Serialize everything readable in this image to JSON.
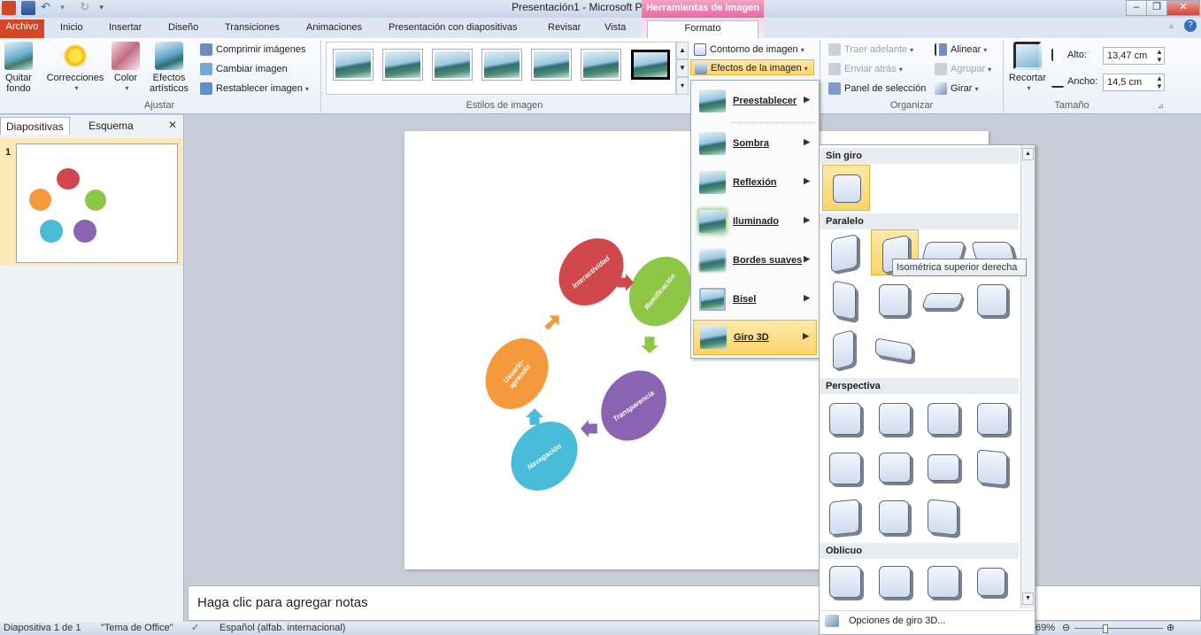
{
  "window": {
    "title": "Presentación1  -  Microsoft PowerPoint",
    "contextual_tab_group": "Herramientas de imagen"
  },
  "tabs": [
    {
      "label": "Archivo"
    },
    {
      "label": "Inicio"
    },
    {
      "label": "Insertar"
    },
    {
      "label": "Diseño"
    },
    {
      "label": "Transiciones"
    },
    {
      "label": "Animaciones"
    },
    {
      "label": "Presentación con diapositivas"
    },
    {
      "label": "Revisar"
    },
    {
      "label": "Vista"
    },
    {
      "label": "Formato"
    }
  ],
  "ribbon": {
    "ajustar": {
      "group_label": "Ajustar",
      "remove_bg": "Quitar\nfondo",
      "corrections": "Correcciones",
      "color": "Color",
      "artistic": "Efectos\nartísticos",
      "compress": "Comprimir imágenes",
      "change": "Cambiar imagen",
      "reset": "Restablecer imagen"
    },
    "estilos": {
      "group_label": "Estilos de imagen",
      "border": "Contorno de imagen",
      "effects": "Efectos de la imagen"
    },
    "organizar": {
      "group_label": "Organizar",
      "bring_forward": "Traer adelante",
      "send_backward": "Enviar atrás",
      "selection_pane": "Panel de selección",
      "align": "Alinear",
      "group": "Agrupar",
      "rotate": "Girar"
    },
    "tamano": {
      "group_label": "Tamaño",
      "crop": "Recortar",
      "height_label": "Alto:",
      "height_value": "13,47 cm",
      "width_label": "Ancho:",
      "width_value": "14,5 cm"
    }
  },
  "left_panel": {
    "tab_slides": "Diapositivas",
    "tab_outline": "Esquema",
    "close": "✕",
    "slide_number": "1"
  },
  "slide": {
    "shapes": [
      {
        "label": "Interactividad",
        "color": "#d0484b"
      },
      {
        "label": "Ramificación",
        "color": "#8ec646"
      },
      {
        "label": "Transparencia",
        "color": "#8a63b3"
      },
      {
        "label": "Navegación",
        "color": "#48bcd9"
      },
      {
        "label": "Usuario-aprendiz",
        "color": "#f59a3c"
      }
    ],
    "arrow_colors": [
      "#d0484b",
      "#8ec646",
      "#8a63b3",
      "#48bcd9",
      "#f59a3c"
    ]
  },
  "notes": {
    "placeholder": "Haga clic para agregar notas"
  },
  "status": {
    "slide": "Diapositiva 1 de 1",
    "theme": "\"Tema de Office\"",
    "language": "Español (alfab. internacional)",
    "zoom": "69%"
  },
  "effects_menu": {
    "items": [
      {
        "label": "Preestablecer"
      },
      {
        "label": "Sombra"
      },
      {
        "label": "Reflexión"
      },
      {
        "label": "Iluminado"
      },
      {
        "label": "Bordes suaves"
      },
      {
        "label": "Bisel"
      },
      {
        "label": "Giro 3D"
      }
    ]
  },
  "rotation_panel": {
    "sections": [
      {
        "title": "Sin giro"
      },
      {
        "title": "Paralelo"
      },
      {
        "title": "Perspectiva"
      },
      {
        "title": "Oblicuo"
      }
    ],
    "options": "Opciones de giro 3D...",
    "tooltip": "Isométrica superior derecha"
  }
}
